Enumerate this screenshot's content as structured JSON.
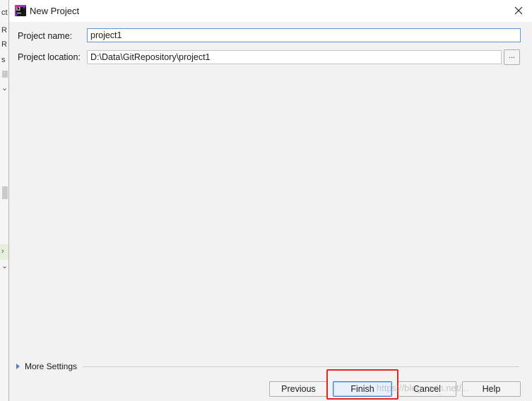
{
  "background": {
    "strip_labels": [
      "ct",
      "R",
      "R",
      "s"
    ]
  },
  "dialog": {
    "title": "New Project",
    "fields": {
      "project_name_label": "Project name:",
      "project_name_value": "project1",
      "project_location_label": "Project location:",
      "project_location_value": "D:\\Data\\GitRepository\\project1",
      "browse_label": "..."
    },
    "more_settings_label": "More Settings",
    "buttons": {
      "previous": "Previous",
      "finish": "Finish",
      "cancel": "Cancel",
      "help": "Help"
    },
    "watermark": "https://blog.csdn.net/..."
  },
  "colors": {
    "annotation_box": "#e8231b",
    "focus_border": "#5b9bd5",
    "default_button_border": "#3a7fd6"
  },
  "icons": {
    "app": "intellij-idea-icon",
    "close": "close-icon",
    "expand": "triangle-right-icon"
  }
}
